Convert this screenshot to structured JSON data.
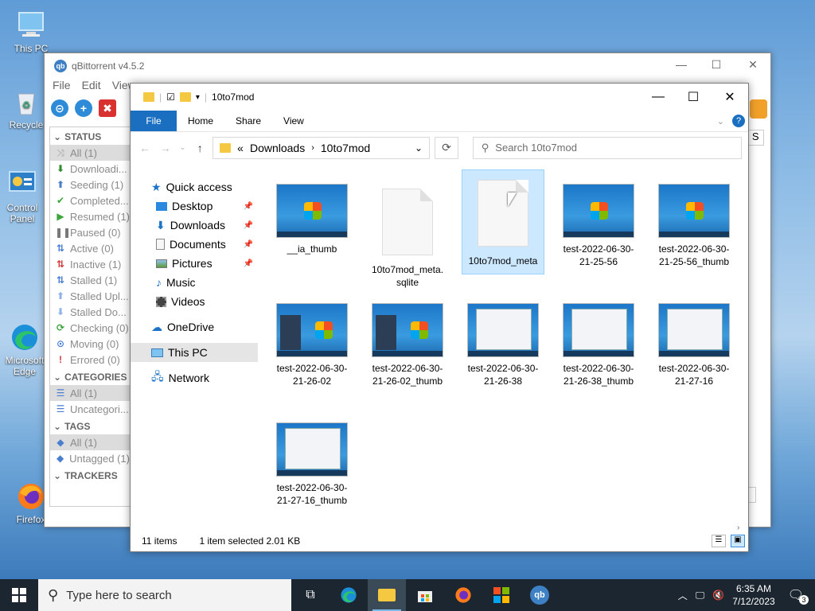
{
  "desktop": {
    "icons": [
      {
        "label": "This PC"
      },
      {
        "label": "Recycle"
      },
      {
        "label": "Control Panel"
      },
      {
        "label": "Microsoft Edge"
      },
      {
        "label": "Firefox"
      }
    ]
  },
  "qbittorrent": {
    "title": "qBittorrent v4.5.2",
    "menu": [
      "File",
      "Edit",
      "View"
    ],
    "status_header": "STATUS",
    "status_items": [
      {
        "label": "All (1)",
        "icon": "⤨",
        "color": "#bbbbbb"
      },
      {
        "label": "Downloadi...",
        "icon": "⬇",
        "color": "#2e8b2e"
      },
      {
        "label": "Seeding (1)",
        "icon": "⬆",
        "color": "#4a7fd0"
      },
      {
        "label": "Completed...",
        "icon": "✔",
        "color": "#3aa53a"
      },
      {
        "label": "Resumed (1)",
        "icon": "▶",
        "color": "#3aa53a"
      },
      {
        "label": "Paused (0)",
        "icon": "❚❚",
        "color": "#777777"
      },
      {
        "label": "Active (0)",
        "icon": "⇅",
        "color": "#4a7fd0"
      },
      {
        "label": "Inactive (1)",
        "icon": "⇅",
        "color": "#d33a3a"
      },
      {
        "label": "Stalled (1)",
        "icon": "⇅",
        "color": "#4a7fd0"
      },
      {
        "label": "Stalled Upl...",
        "icon": "⬆",
        "color": "#8fb3e8"
      },
      {
        "label": "Stalled Do...",
        "icon": "⬇",
        "color": "#8fb3e8"
      },
      {
        "label": "Checking (0)",
        "icon": "⟳",
        "color": "#3aa53a"
      },
      {
        "label": "Moving (0)",
        "icon": "⊙",
        "color": "#4a7fd0"
      },
      {
        "label": "Errored (0)",
        "icon": "!",
        "color": "#d33a3a"
      }
    ],
    "categories_header": "CATEGORIES",
    "category_items": [
      {
        "label": "All (1)"
      },
      {
        "label": "Uncategori..."
      }
    ],
    "tags_header": "TAGS",
    "tag_items": [
      {
        "label": "All (1)"
      },
      {
        "label": "Untagged (1)"
      }
    ],
    "trackers_header": "TRACKERS",
    "right_fragment_top": "o S",
    "right_fragment_bottom": "d"
  },
  "explorer": {
    "title": "10to7mod",
    "ribbon_tabs": [
      "File",
      "Home",
      "Share",
      "View"
    ],
    "breadcrumb": {
      "prefix": "«",
      "parts": [
        "Downloads",
        "10to7mod"
      ]
    },
    "search_placeholder": "Search 10to7mod",
    "nav": {
      "quick_access": "Quick access",
      "pinned": [
        {
          "label": "Desktop",
          "pinned": true
        },
        {
          "label": "Downloads",
          "pinned": true
        },
        {
          "label": "Documents",
          "pinned": true
        },
        {
          "label": "Pictures",
          "pinned": true
        },
        {
          "label": "Music",
          "pinned": false
        },
        {
          "label": "Videos",
          "pinned": false
        }
      ],
      "onedrive": "OneDrive",
      "this_pc": "This PC",
      "network": "Network"
    },
    "files": [
      {
        "name": "__ia_thumb",
        "kind": "img-win"
      },
      {
        "name": "10to7mod_meta.sqlite",
        "kind": "doc"
      },
      {
        "name": "10to7mod_meta",
        "kind": "doc",
        "selected": true
      },
      {
        "name": "test-2022-06-30-21-25-56",
        "kind": "img-win"
      },
      {
        "name": "test-2022-06-30-21-25-56_thumb",
        "kind": "img-win"
      },
      {
        "name": "test-2022-06-30-21-26-02",
        "kind": "img-menu"
      },
      {
        "name": "test-2022-06-30-21-26-02_thumb",
        "kind": "img-menu"
      },
      {
        "name": "test-2022-06-30-21-26-38",
        "kind": "img-dialog"
      },
      {
        "name": "test-2022-06-30-21-26-38_thumb",
        "kind": "img-dialog"
      },
      {
        "name": "test-2022-06-30-21-27-16",
        "kind": "img-dialog"
      },
      {
        "name": "test-2022-06-30-21-27-16_thumb",
        "kind": "img-dialog"
      }
    ],
    "status": {
      "items": "11 items",
      "selected": "1 item selected  2.01 KB"
    }
  },
  "taskbar": {
    "search_placeholder": "Type here to search",
    "time": "6:35 AM",
    "date": "7/12/2023",
    "notifications": "3"
  }
}
